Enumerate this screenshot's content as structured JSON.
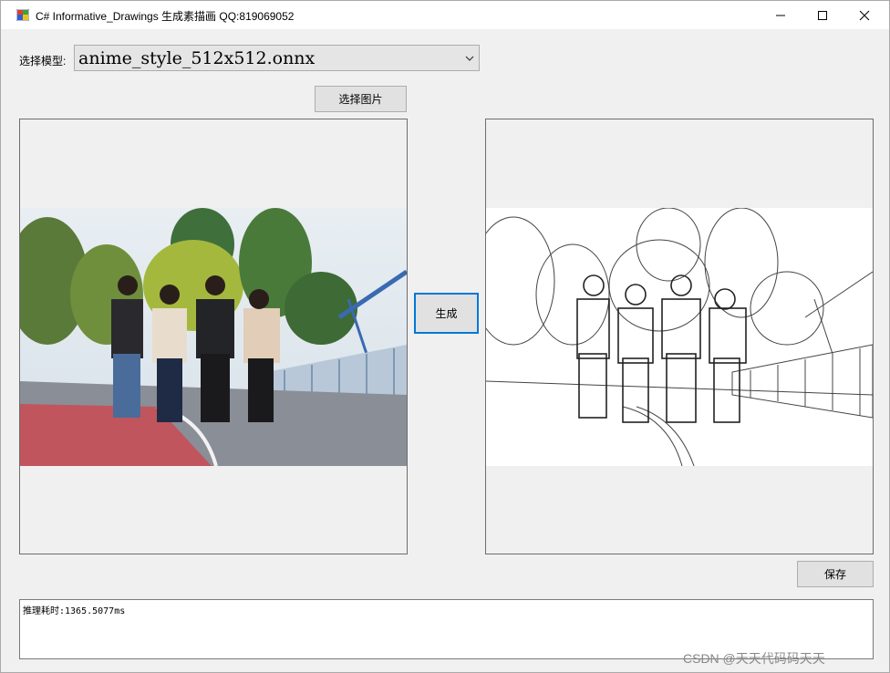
{
  "window": {
    "title": "C# Informative_Drawings 生成素描画 QQ:819069052"
  },
  "model": {
    "label": "选择模型:",
    "selected": "anime_style_512x512.onnx"
  },
  "buttons": {
    "select_image": "选择图片",
    "generate": "生成",
    "save": "保存"
  },
  "log": {
    "text": "推理耗时:1365.5077ms"
  },
  "images": {
    "left": "photo-four-people-walking",
    "right": "sketch-four-people-walking"
  },
  "watermark": "CSDN @天天代码码天天",
  "colors": {
    "accent": "#0078d7",
    "background": "#f0f0f0",
    "button": "#e1e1e1"
  }
}
